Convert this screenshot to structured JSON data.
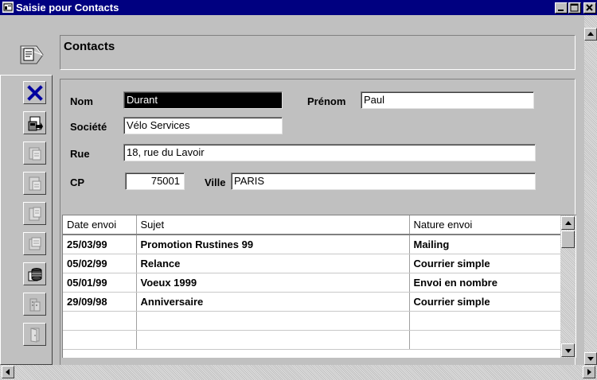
{
  "window": {
    "title": "Saisie pour  Contacts"
  },
  "header": {
    "title": "Contacts"
  },
  "toolbar": {
    "icons": [
      "delete-icon",
      "save-icon",
      "copy-icon",
      "print-icon",
      "print-preview-icon",
      "list-icon",
      "database-icon",
      "building-icon",
      "exit-door-icon"
    ]
  },
  "form": {
    "nom": {
      "label": "Nom",
      "value": "Durant"
    },
    "prenom": {
      "label": "Prénom",
      "value": "Paul"
    },
    "societe": {
      "label": "Société",
      "value": "Vélo Services"
    },
    "rue": {
      "label": "Rue",
      "value": "18, rue du Lavoir"
    },
    "cp": {
      "label": "CP",
      "value": "75001"
    },
    "ville": {
      "label": "Ville",
      "value": "PARIS"
    }
  },
  "table": {
    "columns": [
      "Date envoi",
      "Sujet",
      "Nature envoi"
    ],
    "rows": [
      [
        "25/03/99",
        "Promotion Rustines 99",
        "Mailing"
      ],
      [
        "05/02/99",
        "Relance",
        "Courrier simple"
      ],
      [
        "05/01/99",
        "Voeux 1999",
        "Envoi en nombre"
      ],
      [
        "29/09/98",
        "Anniversaire",
        "Courrier simple"
      ],
      [
        "",
        "",
        ""
      ],
      [
        "",
        "",
        ""
      ]
    ]
  }
}
